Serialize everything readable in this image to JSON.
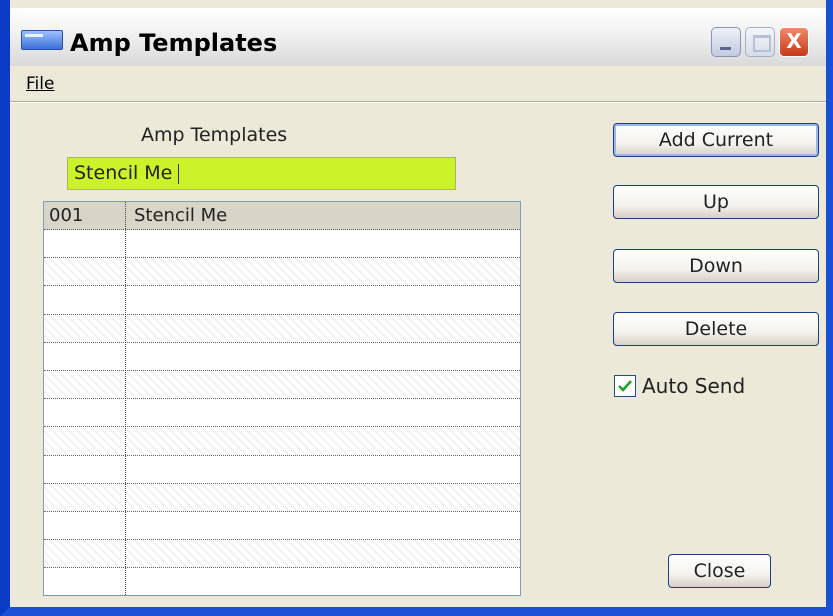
{
  "window": {
    "title": "Amp Templates",
    "close_glyph": "X"
  },
  "menu": {
    "file_prefix": "F",
    "file_rest": "ile"
  },
  "panel": {
    "label": "Amp Templates",
    "name_value": "Stencil Me"
  },
  "list": {
    "rows": [
      {
        "num": "001",
        "name": "Stencil Me"
      },
      {
        "num": "",
        "name": ""
      },
      {
        "num": "",
        "name": ""
      },
      {
        "num": "",
        "name": ""
      },
      {
        "num": "",
        "name": ""
      },
      {
        "num": "",
        "name": ""
      },
      {
        "num": "",
        "name": ""
      },
      {
        "num": "",
        "name": ""
      },
      {
        "num": "",
        "name": ""
      },
      {
        "num": "",
        "name": ""
      },
      {
        "num": "",
        "name": ""
      },
      {
        "num": "",
        "name": ""
      },
      {
        "num": "",
        "name": ""
      },
      {
        "num": "",
        "name": ""
      }
    ]
  },
  "buttons": {
    "add_current": "Add Current",
    "up": "Up",
    "down": "Down",
    "delete": "Delete",
    "close": "Close"
  },
  "auto_send": {
    "label": "Auto Send",
    "checked": true
  },
  "colors": {
    "input_bg": "#ccf22a",
    "selected_row": "#d8d4c7",
    "frame": "#1a4fd8"
  }
}
